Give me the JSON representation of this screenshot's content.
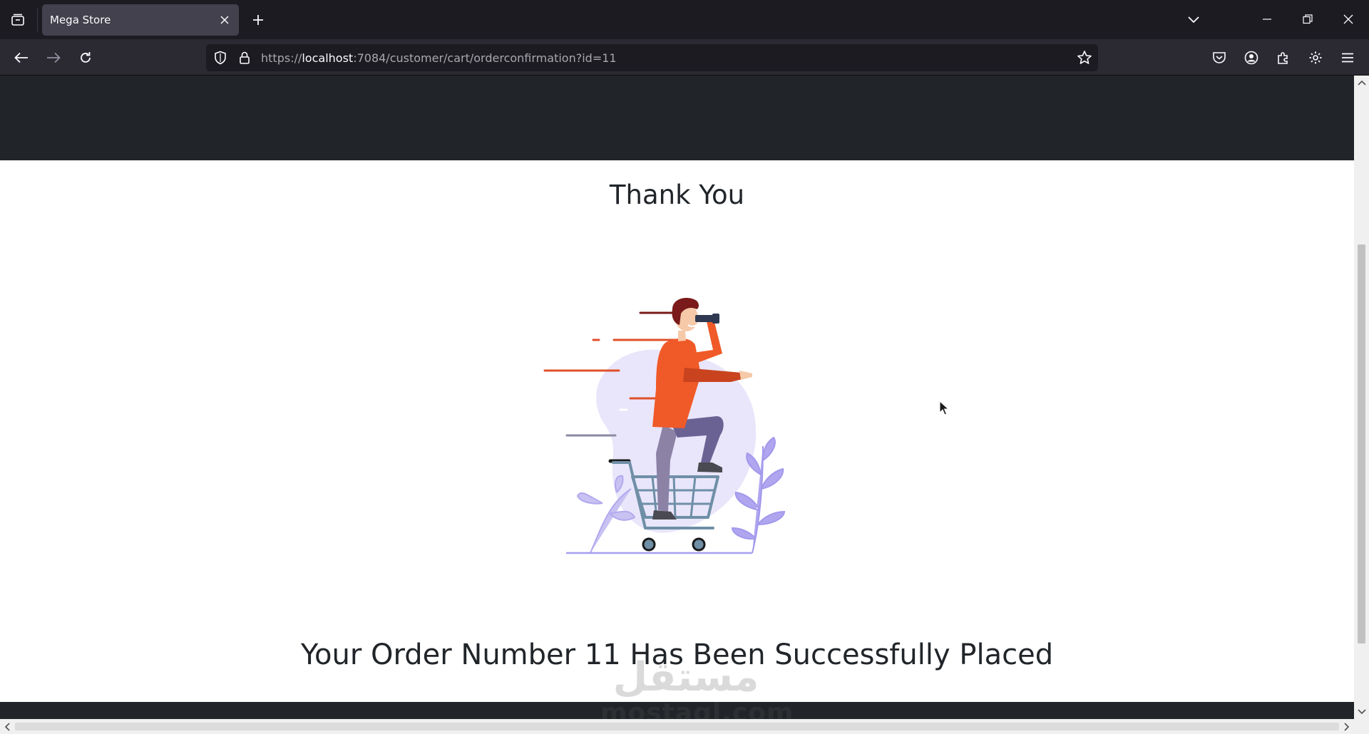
{
  "browser": {
    "tab_title": "Mega Store",
    "url_scheme_prefix": "https://",
    "url_host": "localhost",
    "url_rest": ":7084/customer/cart/orderconfirmation?id=11",
    "icons": [
      "tab-list-icon",
      "close-icon",
      "plus-icon",
      "chevron-down-icon",
      "minimize-icon",
      "restore-icon",
      "close-window-icon",
      "back-arrow-icon",
      "forward-arrow-icon",
      "reload-icon",
      "shield-icon",
      "lock-icon",
      "star-icon",
      "pocket-icon",
      "account-icon",
      "extensions-icon",
      "gear-icon",
      "menu-icon"
    ]
  },
  "page": {
    "heading": "Thank You",
    "order_message": "Your Order Number 11 Has Been Successfully Placed",
    "illustration": "person-on-shopping-cart-with-binoculars-illustration"
  },
  "watermark": {
    "arabic": "مستقل",
    "latin": "mostaql.com"
  },
  "colors": {
    "chrome_dark": "#1c1b22",
    "toolbar": "#2b2a33",
    "site_header": "#212529",
    "accent_orange": "#f05a28",
    "lavender": "#e9e6fb",
    "cart_blue": "#6f8fa6"
  }
}
